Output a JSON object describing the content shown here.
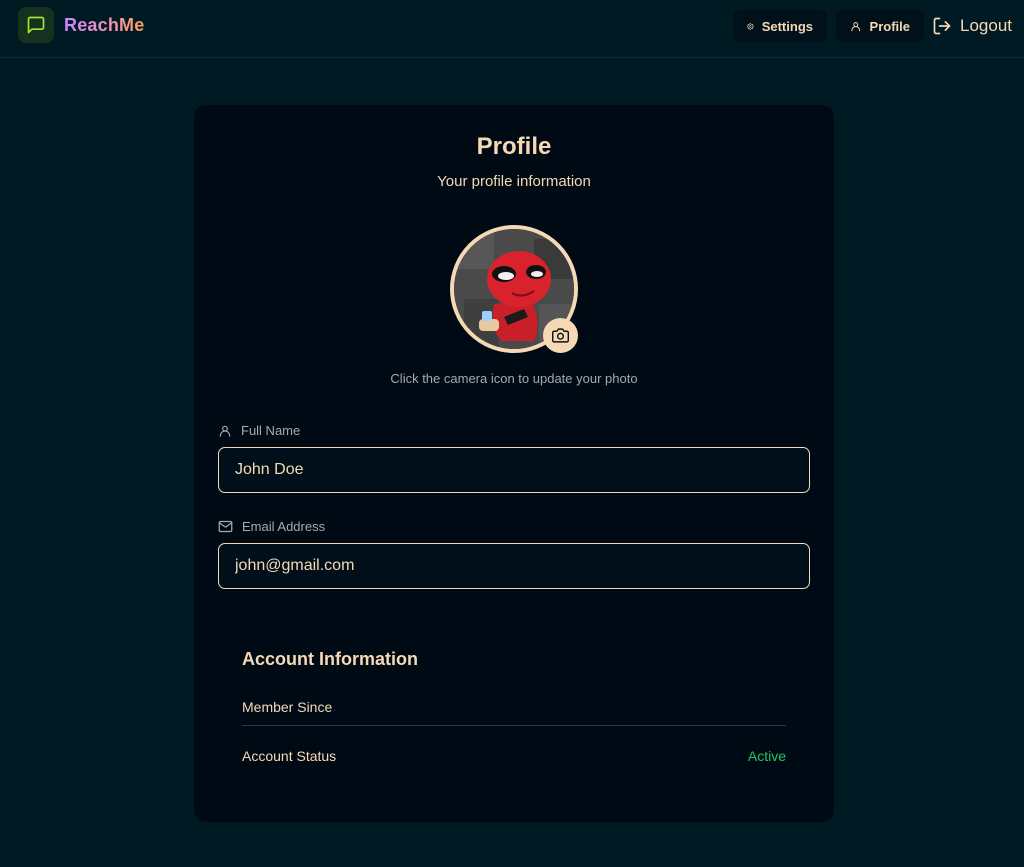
{
  "header": {
    "brand": "ReachMe",
    "nav": {
      "settings_label": "Settings",
      "profile_label": "Profile",
      "logout_label": "Logout"
    }
  },
  "profile": {
    "title": "Profile",
    "subtitle": "Your profile information",
    "avatar_hint": "Click the camera icon to update your photo",
    "fields": {
      "full_name": {
        "label": "Full Name",
        "value": "John Doe"
      },
      "email": {
        "label": "Email Address",
        "value": "john@gmail.com"
      }
    },
    "account_info": {
      "title": "Account Information",
      "member_since_label": "Member Since",
      "member_since_value": "",
      "status_label": "Account Status",
      "status_value": "Active"
    }
  },
  "colors": {
    "background": "#001a24",
    "card": "#000a14",
    "accent": "#f5d9b5",
    "logo_green": "#a3e635",
    "status_active": "#22c55e"
  },
  "icons": {
    "logo": "message-square-icon",
    "settings": "gear-icon",
    "profile": "user-icon",
    "logout": "logout-icon",
    "camera": "camera-icon",
    "name_field": "user-icon",
    "email_field": "mail-icon"
  }
}
